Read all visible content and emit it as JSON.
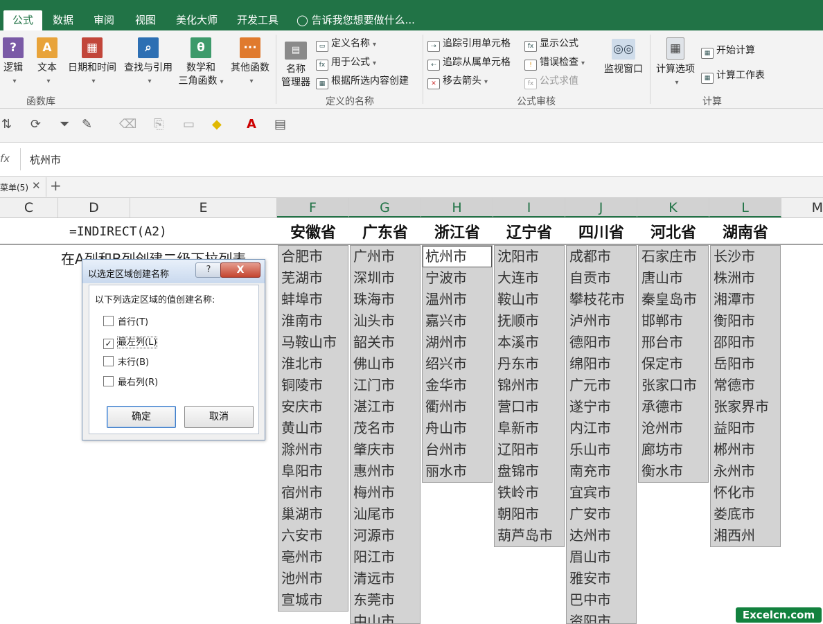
{
  "ribbon_tabs": [
    {
      "label": "公式",
      "active": true
    },
    {
      "label": "数据"
    },
    {
      "label": "审阅"
    },
    {
      "label": "视图"
    },
    {
      "label": "美化大师"
    },
    {
      "label": "开发工具"
    }
  ],
  "tell_me": "告诉我您想要做什么...",
  "library_group": {
    "label": "函数库",
    "buttons": [
      "逻辑",
      "文本",
      "日期和时间",
      "查找与引用",
      "数学和",
      "三角函数",
      "其他函数"
    ]
  },
  "names_group": {
    "label": "定义的名称",
    "manager_line1": "名称",
    "manager_line2": "管理器",
    "define_name": "定义名称",
    "use_in_formula": "用于公式",
    "create_from_selection": "根据所选内容创建"
  },
  "audit_group": {
    "label": "公式审核",
    "trace_precedents": "追踪引用单元格",
    "trace_dependents": "追踪从属单元格",
    "remove_arrows": "移去箭头",
    "show_formulas": "显示公式",
    "error_checking": "错误检查",
    "evaluate_formula": "公式求值",
    "watch_window": "监视窗口"
  },
  "calc_group": {
    "label": "计算",
    "options": "计算选项",
    "calc_now": "开始计算",
    "calc_sheet": "计算工作表"
  },
  "formula_bar": {
    "fx": "fx",
    "value": "杭州市"
  },
  "sheet_tab": "菜单(5)",
  "columns": [
    {
      "label": "C"
    },
    {
      "label": "D"
    },
    {
      "label": "E"
    },
    {
      "label": "F",
      "sel": true
    },
    {
      "label": "G",
      "sel": true
    },
    {
      "label": "H",
      "sel": true
    },
    {
      "label": "I",
      "sel": true
    },
    {
      "label": "J",
      "sel": true
    },
    {
      "label": "K",
      "sel": true
    },
    {
      "label": "L",
      "sel": true
    },
    {
      "label": "M"
    }
  ],
  "formula_text": "=INDIRECT(A2)",
  "note_text": "在A列和B列创建二级下拉列表",
  "provinces": [
    {
      "name": "安徽省",
      "cities": [
        "合肥市",
        "芜湖市",
        "蚌埠市",
        "淮南市",
        "马鞍山市",
        "淮北市",
        "铜陵市",
        "安庆市",
        "黄山市",
        "滁州市",
        "阜阳市",
        "宿州市",
        "巢湖市",
        "六安市",
        "亳州市",
        "池州市",
        "宣城市"
      ]
    },
    {
      "name": "广东省",
      "cities": [
        "广州市",
        "深圳市",
        "珠海市",
        "汕头市",
        "韶关市",
        "佛山市",
        "江门市",
        "湛江市",
        "茂名市",
        "肇庆市",
        "惠州市",
        "梅州市",
        "汕尾市",
        "河源市",
        "阳江市",
        "清远市",
        "东莞市",
        "中山市"
      ]
    },
    {
      "name": "浙江省",
      "cities": [
        "杭州市",
        "宁波市",
        "温州市",
        "嘉兴市",
        "湖州市",
        "绍兴市",
        "金华市",
        "衢州市",
        "舟山市",
        "台州市",
        "丽水市"
      ]
    },
    {
      "name": "辽宁省",
      "cities": [
        "沈阳市",
        "大连市",
        "鞍山市",
        "抚顺市",
        "本溪市",
        "丹东市",
        "锦州市",
        "营口市",
        "阜新市",
        "辽阳市",
        "盘锦市",
        "铁岭市",
        "朝阳市",
        "葫芦岛市"
      ]
    },
    {
      "name": "四川省",
      "cities": [
        "成都市",
        "自贡市",
        "攀枝花市",
        "泸州市",
        "德阳市",
        "绵阳市",
        "广元市",
        "遂宁市",
        "内江市",
        "乐山市",
        "南充市",
        "宜宾市",
        "广安市",
        "达州市",
        "眉山市",
        "雅安市",
        "巴中市",
        "资阳市"
      ]
    },
    {
      "name": "河北省",
      "cities": [
        "石家庄市",
        "唐山市",
        "秦皇岛市",
        "邯郸市",
        "邢台市",
        "保定市",
        "张家口市",
        "承德市",
        "沧州市",
        "廊坊市",
        "衡水市"
      ]
    },
    {
      "name": "湖南省",
      "cities": [
        "长沙市",
        "株洲市",
        "湘潭市",
        "衡阳市",
        "邵阳市",
        "岳阳市",
        "常德市",
        "张家界市",
        "益阳市",
        "郴州市",
        "永州市",
        "怀化市",
        "娄底市",
        "湘西州"
      ]
    }
  ],
  "dialog": {
    "title": "以选定区域创建名称",
    "help": "?",
    "close": "X",
    "prompt": "以下列选定区域的值创建名称:",
    "options": [
      {
        "label": "首行(T)",
        "checked": false
      },
      {
        "label": "最左列(L)",
        "checked": true
      },
      {
        "label": "末行(B)",
        "checked": false
      },
      {
        "label": "最右列(R)",
        "checked": false
      }
    ],
    "ok": "确定",
    "cancel": "取消"
  },
  "watermark": "Excelcn.com",
  "colors": {
    "excel_green": "#217346",
    "selection_gray": "#d3d3d3",
    "watermark_green": "#12813e"
  }
}
